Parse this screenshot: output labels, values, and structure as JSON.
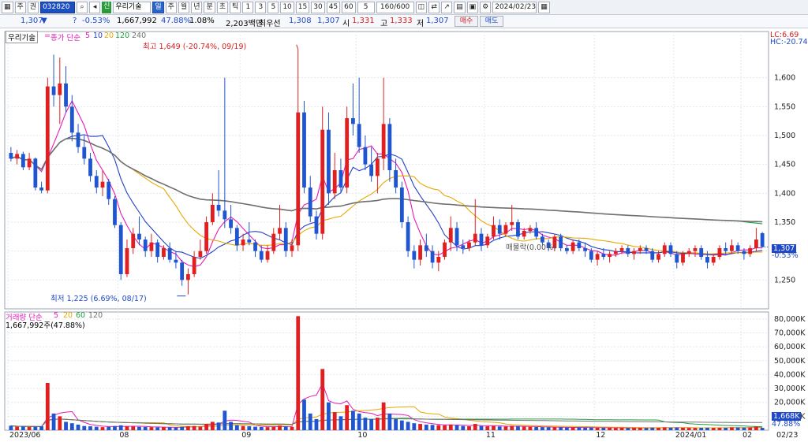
{
  "toolbar": {
    "left_buttons": [
      "主",
      "주",
      "권"
    ],
    "stock_code": "032820",
    "badge": "신",
    "stock_name": "우리기술",
    "period_tabs": [
      "일",
      "주",
      "월",
      "년",
      "분",
      "초",
      "틱"
    ],
    "active_period": "일",
    "minute_intervals": [
      "1",
      "3",
      "5",
      "10",
      "15",
      "30",
      "45",
      "60"
    ],
    "interval_value": "5",
    "count_display": "160/600",
    "date": "2024/02/23"
  },
  "quote": {
    "price": "1,307",
    "arrow": "▼",
    "change": "?",
    "change_pct": "-0.53%",
    "volume": "1,667,992",
    "volume_ratio": "47.88%",
    "turnover_pct": "1.08%",
    "trade_value": "2,203백만",
    "priority_label": "최우선",
    "bid": "1,308",
    "ask": "1,307",
    "open_label": "시",
    "open": "1,331",
    "high_label": "고",
    "high": "1,333",
    "low_label": "저",
    "low": "1,307",
    "buy_button": "매수",
    "sell_button": "매도"
  },
  "price_panel": {
    "name": "우리기술",
    "indicator_label": "종가 단순",
    "ma_periods": [
      "5",
      "10",
      "20",
      "120",
      "240"
    ],
    "ma_colors": [
      "#e61ab8",
      "#2340c8",
      "#e8a800",
      "#20a040",
      "#707070"
    ],
    "max_annotation": "최고 1,649 (-20.74%, 09/19)",
    "min_annotation": "최저 1,225 (6.69%, 08/17)",
    "mid_annotation": "매물락(0.00%)",
    "lc_label": "LC:6.69",
    "hc_label": "HC:-20.74",
    "current_price_tag": "1,307",
    "current_change_tag": "-0.53%",
    "y_ticks": [
      "1,600",
      "1,550",
      "1,500",
      "1,450",
      "1,400",
      "1,350",
      "1,300",
      "1,250"
    ]
  },
  "volume_panel": {
    "label": "거래량 단순",
    "ma_periods": [
      "5",
      "20",
      "60",
      "120"
    ],
    "ma_colors": [
      "#e61ab8",
      "#e8a800",
      "#20a040",
      "#707070"
    ],
    "current": "1,667,992주(47.88%)",
    "current_tag": "1,668K",
    "current_pct_tag": "47.88%",
    "y_ticks": [
      "80,000K",
      "70,000K",
      "60,000K",
      "50,000K",
      "40,000K",
      "30,000K",
      "20,000K",
      "10,000K"
    ]
  },
  "x_axis": {
    "labels": [
      "2023/06",
      "08",
      "09",
      "10",
      "11",
      "12",
      "2024/01",
      "02"
    ],
    "end_label": "02/23"
  },
  "chart_data": {
    "type": "candlestick",
    "price_range": [
      1200,
      1680
    ],
    "volume_range": [
      0,
      85000
    ],
    "candles_ohlcv": [
      [
        1470,
        1480,
        1455,
        1460,
        3200
      ],
      [
        1460,
        1475,
        1450,
        1468,
        2500
      ],
      [
        1468,
        1472,
        1440,
        1445,
        2600
      ],
      [
        1445,
        1470,
        1440,
        1460,
        2300
      ],
      [
        1460,
        1462,
        1405,
        1410,
        2500
      ],
      [
        1410,
        1420,
        1400,
        1405,
        2800
      ],
      [
        1405,
        1600,
        1400,
        1585,
        34000
      ],
      [
        1585,
        1640,
        1550,
        1570,
        12000
      ],
      [
        1570,
        1635,
        1520,
        1590,
        10000
      ],
      [
        1590,
        1620,
        1540,
        1550,
        6000
      ],
      [
        1550,
        1570,
        1490,
        1505,
        5000
      ],
      [
        1505,
        1520,
        1470,
        1480,
        4000
      ],
      [
        1480,
        1500,
        1450,
        1460,
        3000
      ],
      [
        1460,
        1470,
        1420,
        1430,
        2800
      ],
      [
        1430,
        1440,
        1400,
        1410,
        2500
      ],
      [
        1410,
        1440,
        1395,
        1420,
        2200
      ],
      [
        1420,
        1425,
        1380,
        1390,
        2400
      ],
      [
        1390,
        1395,
        1340,
        1345,
        3000
      ],
      [
        1345,
        1350,
        1250,
        1260,
        3500
      ],
      [
        1260,
        1320,
        1255,
        1305,
        2800
      ],
      [
        1305,
        1340,
        1295,
        1330,
        2600
      ],
      [
        1330,
        1360,
        1310,
        1320,
        2400
      ],
      [
        1320,
        1325,
        1290,
        1300,
        2300
      ],
      [
        1300,
        1330,
        1290,
        1315,
        2200
      ],
      [
        1315,
        1320,
        1280,
        1290,
        2000
      ],
      [
        1290,
        1310,
        1285,
        1305,
        2100
      ],
      [
        1305,
        1315,
        1280,
        1285,
        2000
      ],
      [
        1285,
        1300,
        1270,
        1280,
        1900
      ],
      [
        1280,
        1285,
        1240,
        1250,
        2400
      ],
      [
        1250,
        1270,
        1225,
        1260,
        2800
      ],
      [
        1260,
        1300,
        1255,
        1290,
        3000
      ],
      [
        1290,
        1320,
        1285,
        1300,
        2600
      ],
      [
        1300,
        1360,
        1295,
        1350,
        4500
      ],
      [
        1350,
        1400,
        1345,
        1380,
        6000
      ],
      [
        1380,
        1440,
        1360,
        1370,
        5500
      ],
      [
        1370,
        1600,
        1340,
        1355,
        14000
      ],
      [
        1355,
        1380,
        1330,
        1340,
        6000
      ],
      [
        1340,
        1345,
        1300,
        1310,
        3500
      ],
      [
        1310,
        1330,
        1300,
        1320,
        3000
      ],
      [
        1320,
        1350,
        1310,
        1315,
        2800
      ],
      [
        1315,
        1320,
        1290,
        1300,
        2500
      ],
      [
        1300,
        1310,
        1280,
        1285,
        2300
      ],
      [
        1285,
        1310,
        1280,
        1300,
        2200
      ],
      [
        1300,
        1340,
        1295,
        1330,
        2600
      ],
      [
        1330,
        1380,
        1320,
        1340,
        3200
      ],
      [
        1340,
        1350,
        1290,
        1300,
        2800
      ],
      [
        1300,
        1320,
        1290,
        1310,
        2400
      ],
      [
        1310,
        1649,
        1300,
        1540,
        82000
      ],
      [
        1540,
        1560,
        1400,
        1410,
        22000
      ],
      [
        1410,
        1430,
        1350,
        1360,
        12000
      ],
      [
        1360,
        1370,
        1320,
        1330,
        8000
      ],
      [
        1330,
        1550,
        1320,
        1510,
        44000
      ],
      [
        1510,
        1540,
        1380,
        1400,
        20000
      ],
      [
        1400,
        1470,
        1390,
        1440,
        13000
      ],
      [
        1440,
        1460,
        1400,
        1410,
        10000
      ],
      [
        1410,
        1550,
        1400,
        1530,
        18000
      ],
      [
        1530,
        1590,
        1500,
        1520,
        14000
      ],
      [
        1520,
        1600,
        1470,
        1480,
        12000
      ],
      [
        1480,
        1500,
        1440,
        1450,
        9000
      ],
      [
        1450,
        1480,
        1420,
        1430,
        8000
      ],
      [
        1430,
        1470,
        1400,
        1460,
        9000
      ],
      [
        1460,
        1600,
        1440,
        1520,
        20000
      ],
      [
        1520,
        1530,
        1420,
        1440,
        12000
      ],
      [
        1440,
        1460,
        1400,
        1410,
        8000
      ],
      [
        1410,
        1420,
        1340,
        1350,
        7000
      ],
      [
        1350,
        1360,
        1290,
        1300,
        6000
      ],
      [
        1300,
        1310,
        1270,
        1285,
        5000
      ],
      [
        1285,
        1320,
        1275,
        1310,
        4500
      ],
      [
        1310,
        1330,
        1290,
        1300,
        4000
      ],
      [
        1300,
        1310,
        1270,
        1280,
        3800
      ],
      [
        1280,
        1300,
        1265,
        1290,
        3600
      ],
      [
        1290,
        1320,
        1285,
        1315,
        3500
      ],
      [
        1315,
        1360,
        1300,
        1340,
        4000
      ],
      [
        1340,
        1350,
        1300,
        1310,
        3500
      ],
      [
        1310,
        1320,
        1295,
        1305,
        3000
      ],
      [
        1305,
        1320,
        1300,
        1315,
        2800
      ],
      [
        1315,
        1390,
        1310,
        1330,
        4500
      ],
      [
        1330,
        1340,
        1300,
        1310,
        3000
      ],
      [
        1310,
        1330,
        1305,
        1325,
        2800
      ],
      [
        1325,
        1360,
        1320,
        1345,
        3000
      ],
      [
        1345,
        1355,
        1320,
        1330,
        2700
      ],
      [
        1330,
        1350,
        1325,
        1345,
        2600
      ],
      [
        1345,
        1380,
        1335,
        1350,
        3200
      ],
      [
        1350,
        1355,
        1320,
        1325,
        2800
      ],
      [
        1325,
        1340,
        1320,
        1335,
        2500
      ],
      [
        1335,
        1345,
        1330,
        1340,
        2400
      ],
      [
        1340,
        1350,
        1320,
        1325,
        2300
      ],
      [
        1325,
        1330,
        1310,
        1315,
        2200
      ],
      [
        1315,
        1320,
        1300,
        1305,
        2100
      ],
      [
        1305,
        1330,
        1300,
        1325,
        2000
      ],
      [
        1325,
        1330,
        1300,
        1305,
        2000
      ],
      [
        1305,
        1310,
        1295,
        1300,
        1900
      ],
      [
        1300,
        1320,
        1295,
        1315,
        2000
      ],
      [
        1315,
        1320,
        1300,
        1305,
        1900
      ],
      [
        1305,
        1315,
        1290,
        1300,
        1800
      ],
      [
        1300,
        1305,
        1280,
        1285,
        1900
      ],
      [
        1285,
        1300,
        1275,
        1295,
        1800
      ],
      [
        1295,
        1305,
        1285,
        1290,
        1700
      ],
      [
        1290,
        1300,
        1280,
        1295,
        1700
      ],
      [
        1295,
        1305,
        1290,
        1300,
        1600
      ],
      [
        1300,
        1310,
        1295,
        1305,
        1700
      ],
      [
        1305,
        1310,
        1290,
        1295,
        1600
      ],
      [
        1295,
        1305,
        1285,
        1300,
        1600
      ],
      [
        1300,
        1310,
        1295,
        1305,
        1700
      ],
      [
        1305,
        1310,
        1295,
        1300,
        1600
      ],
      [
        1300,
        1305,
        1280,
        1285,
        1800
      ],
      [
        1285,
        1300,
        1280,
        1295,
        1700
      ],
      [
        1295,
        1315,
        1290,
        1310,
        2000
      ],
      [
        1310,
        1315,
        1290,
        1295,
        1800
      ],
      [
        1295,
        1300,
        1270,
        1280,
        1900
      ],
      [
        1280,
        1300,
        1275,
        1295,
        1700
      ],
      [
        1295,
        1305,
        1290,
        1300,
        1600
      ],
      [
        1300,
        1310,
        1290,
        1305,
        1600
      ],
      [
        1305,
        1310,
        1285,
        1290,
        1700
      ],
      [
        1290,
        1300,
        1270,
        1280,
        1800
      ],
      [
        1280,
        1295,
        1275,
        1290,
        1700
      ],
      [
        1290,
        1310,
        1285,
        1305,
        1800
      ],
      [
        1305,
        1315,
        1295,
        1300,
        1700
      ],
      [
        1300,
        1320,
        1295,
        1310,
        2000
      ],
      [
        1310,
        1315,
        1295,
        1300,
        1900
      ],
      [
        1300,
        1305,
        1285,
        1295,
        1800
      ],
      [
        1295,
        1310,
        1290,
        1305,
        1900
      ],
      [
        1305,
        1340,
        1300,
        1320,
        2600
      ],
      [
        1331,
        1333,
        1307,
        1307,
        1668
      ]
    ]
  }
}
